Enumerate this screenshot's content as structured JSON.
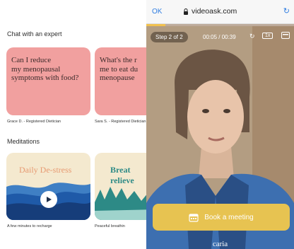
{
  "left": {
    "chat_section_title": "Chat with an expert",
    "expert_cards": [
      {
        "question": "Can I reduce\nmy menopausal\nsymptoms with food?",
        "caption": "Grace D. - Registered Dietician"
      },
      {
        "question": "What's the r\nme to eat du\nmenopause",
        "caption": "Sara S. - Registered Dietician"
      }
    ],
    "meditations_title": "Meditations",
    "meditations": [
      {
        "title": "Daily De-stress",
        "caption": "A few minutes to recharge"
      },
      {
        "title": "Breat\nrelieve",
        "caption": "Peaceful breathin"
      }
    ]
  },
  "browser": {
    "ok_label": "OK",
    "url": "videoask.com"
  },
  "video": {
    "step_label": "Step 2 of 2",
    "time_label": "00:05 / 00:39",
    "speed_label": "1x",
    "progress": 0.13,
    "cta_label": "Book a meeting",
    "brand_label": "caria"
  },
  "colors": {
    "pink_card": "#f1a09f",
    "cta_yellow": "#e7c351",
    "link_blue": "#2f7de1",
    "meditation_navy": "#163d7a",
    "meditation_teal": "#2d8a86"
  }
}
